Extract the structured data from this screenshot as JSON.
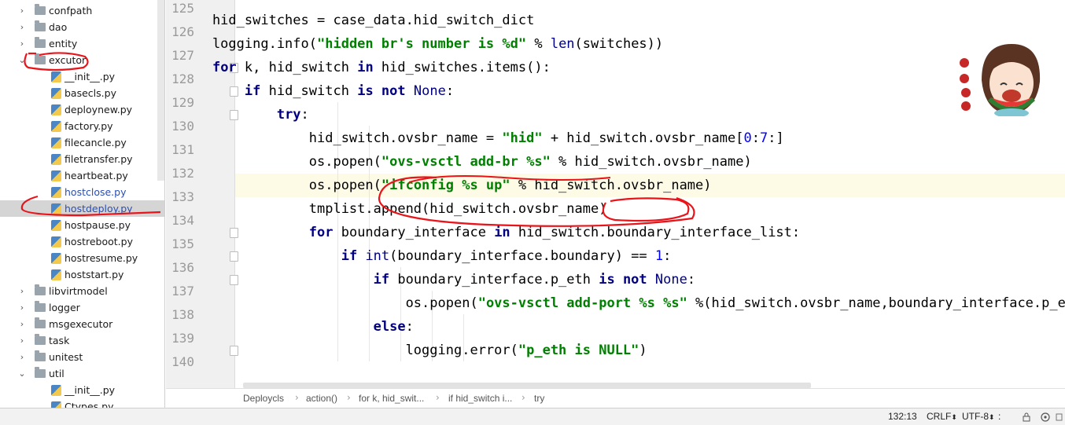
{
  "project_tree": {
    "items": [
      {
        "label": "confpath",
        "kind": "folder",
        "expanded": false
      },
      {
        "label": "dao",
        "kind": "folder",
        "expanded": false
      },
      {
        "label": "entity",
        "kind": "folder",
        "expanded": false
      },
      {
        "label": "excutor",
        "kind": "folder",
        "expanded": true
      },
      {
        "label": "__init__.py",
        "kind": "file"
      },
      {
        "label": "basecls.py",
        "kind": "file"
      },
      {
        "label": "deploynew.py",
        "kind": "file"
      },
      {
        "label": "factory.py",
        "kind": "file"
      },
      {
        "label": "filecancle.py",
        "kind": "file"
      },
      {
        "label": "filetransfer.py",
        "kind": "file"
      },
      {
        "label": "heartbeat.py",
        "kind": "file"
      },
      {
        "label": "hostclose.py",
        "kind": "file"
      },
      {
        "label": "hostdeploy.py",
        "kind": "file",
        "selected": true
      },
      {
        "label": "hostpause.py",
        "kind": "file"
      },
      {
        "label": "hostreboot.py",
        "kind": "file"
      },
      {
        "label": "hostresume.py",
        "kind": "file"
      },
      {
        "label": "hoststart.py",
        "kind": "file"
      },
      {
        "label": "libvirtmodel",
        "kind": "folder",
        "expanded": false
      },
      {
        "label": "logger",
        "kind": "folder",
        "expanded": false
      },
      {
        "label": "msgexecutor",
        "kind": "folder",
        "expanded": false
      },
      {
        "label": "task",
        "kind": "folder",
        "expanded": false
      },
      {
        "label": "unitest",
        "kind": "folder",
        "expanded": false
      },
      {
        "label": "util",
        "kind": "folder",
        "expanded": true
      },
      {
        "label": "__init__.py",
        "kind": "file"
      },
      {
        "label": "Ctypes.py",
        "kind": "file"
      }
    ]
  },
  "editor": {
    "line_numbers": [
      "125",
      "126",
      "127",
      "128",
      "129",
      "130",
      "131",
      "132",
      "133",
      "134",
      "135",
      "136",
      "137",
      "138",
      "139",
      "140"
    ],
    "current_line": "132"
  },
  "breadcrumb": [
    "Deploycls",
    "action()",
    "for k, hid_swit...",
    "if hid_switch i...",
    "try"
  ],
  "status": {
    "position": "132:13",
    "line_ending": "CRLF",
    "encoding": "UTF-8"
  },
  "colors": {
    "keyword": "#000080",
    "string": "#008000",
    "number": "#0000ff",
    "annotation": "#e8141a",
    "current_line": "#fdfbe6"
  },
  "icons": [
    "folder-icon",
    "python-file-icon",
    "chevron-right-icon",
    "chevron-down-icon",
    "lock-icon",
    "git-icon",
    "sticker-image"
  ]
}
